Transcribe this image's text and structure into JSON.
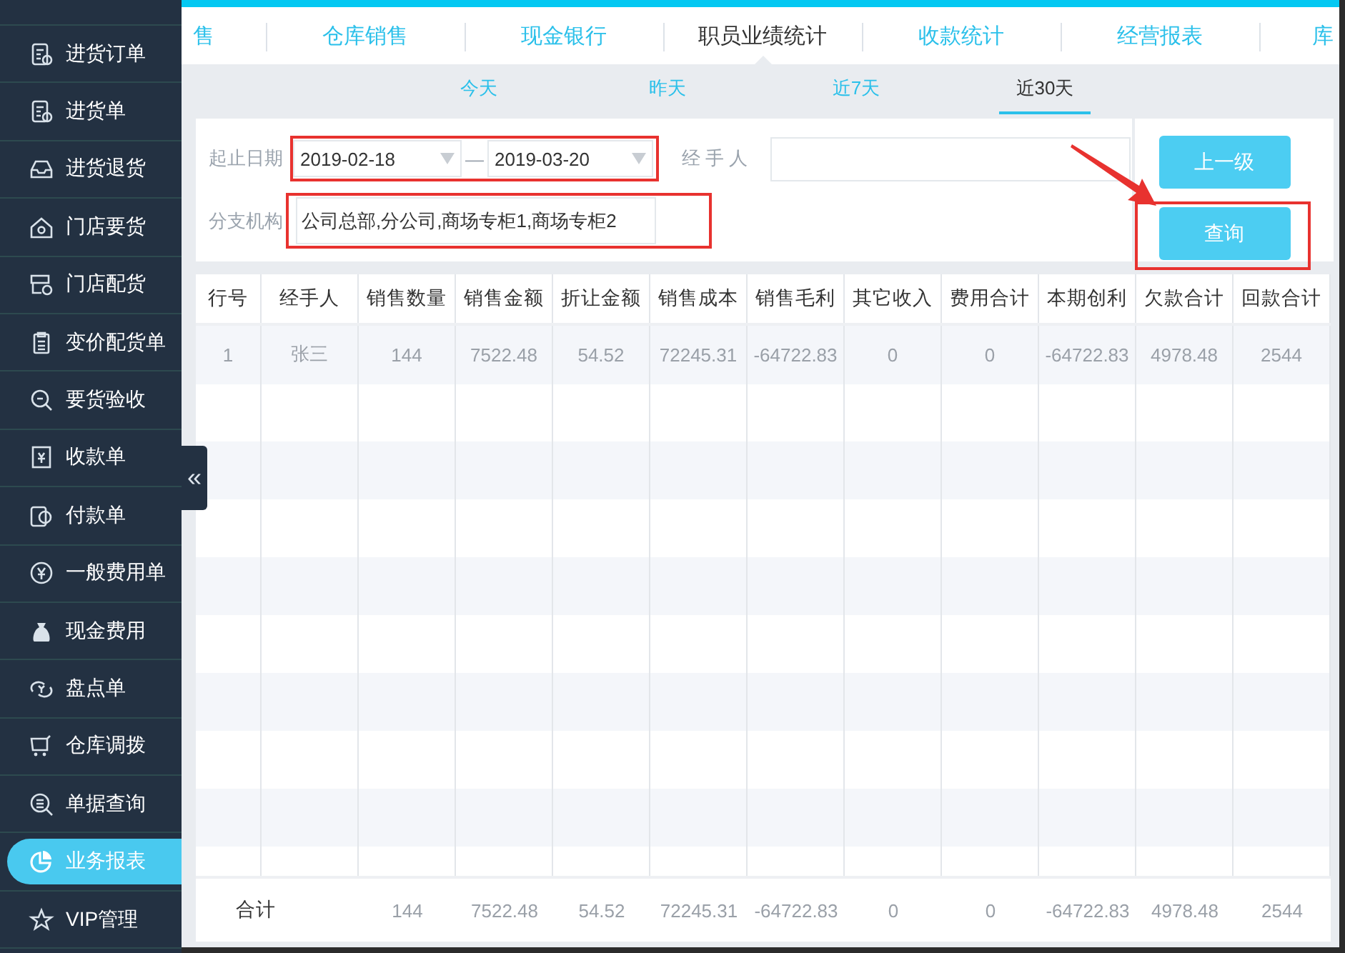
{
  "sidebar": {
    "items": [
      {
        "label": "进货订单",
        "selected": false
      },
      {
        "label": "进货单",
        "selected": false
      },
      {
        "label": "进货退货",
        "selected": false
      },
      {
        "label": "门店要货",
        "selected": false
      },
      {
        "label": "门店配货",
        "selected": false
      },
      {
        "label": "变价配货单",
        "selected": false
      },
      {
        "label": "要货验收",
        "selected": false
      },
      {
        "label": "收款单",
        "selected": false
      },
      {
        "label": "付款单",
        "selected": false
      },
      {
        "label": "一般费用单",
        "selected": false
      },
      {
        "label": "现金费用",
        "selected": false
      },
      {
        "label": "盘点单",
        "selected": false
      },
      {
        "label": "仓库调拨",
        "selected": false
      },
      {
        "label": "单据查询",
        "selected": false
      },
      {
        "label": "业务报表",
        "selected": true
      },
      {
        "label": "VIP管理",
        "selected": false
      }
    ]
  },
  "collapse_handle": {
    "label": "«"
  },
  "tabs": [
    {
      "label": "售",
      "selected": false
    },
    {
      "label": "仓库销售",
      "selected": false
    },
    {
      "label": "现金银行",
      "selected": false
    },
    {
      "label": "职员业绩统计",
      "selected": true
    },
    {
      "label": "收款统计",
      "selected": false
    },
    {
      "label": "经营报表",
      "selected": false
    },
    {
      "label": "库",
      "selected": false
    }
  ],
  "period_tabs": [
    {
      "label": "今天",
      "selected": false
    },
    {
      "label": "昨天",
      "selected": false
    },
    {
      "label": "近7天",
      "selected": false
    },
    {
      "label": "近30天",
      "selected": true
    }
  ],
  "filters": {
    "date_label": "起止日期",
    "start_date": "2019-02-18",
    "separator": "—",
    "end_date": "2019-03-20",
    "dates_highlighted": true,
    "handler_label": "经 手 人",
    "branch_label": "分支机构",
    "branch_value": "公司总部,分公司,商场专柜1,商场专柜2",
    "branch_highlighted": true
  },
  "buttons": [
    {
      "label": "上一级",
      "highlighted": false
    },
    {
      "label": "查询",
      "highlighted": true
    }
  ],
  "annotation_arrow": true,
  "table": {
    "columns": [
      "行号",
      "经手人",
      "销售数量",
      "销售金额",
      "折让金额",
      "销售成本",
      "销售毛利",
      "其它收入",
      "费用合计",
      "本期创利",
      "欠款合计",
      "回款合计"
    ],
    "rows": [
      [
        "1",
        "张三",
        "144",
        "7522.48",
        "54.52",
        "72245.31",
        "-64722.83",
        "0",
        "0",
        "-64722.83",
        "4978.48",
        "2544"
      ]
    ],
    "footer": {
      "label": "合计",
      "values": [
        "144",
        "7522.48",
        "54.52",
        "72245.31",
        "-64722.83",
        "0",
        "0",
        "-64722.83",
        "4978.48",
        "2544"
      ]
    }
  }
}
